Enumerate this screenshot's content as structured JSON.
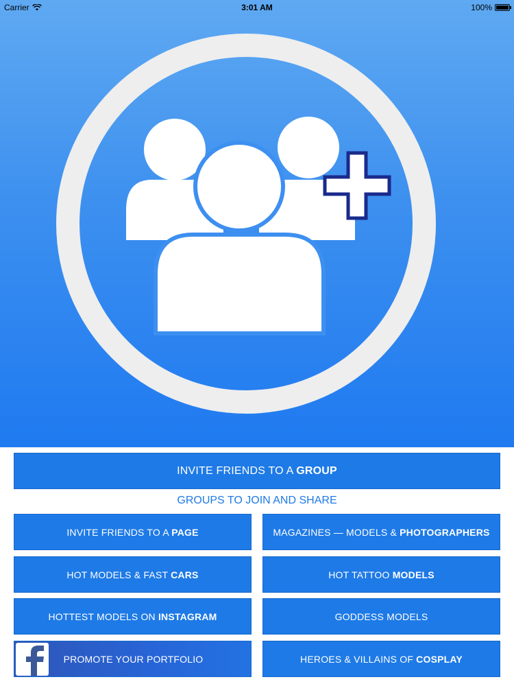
{
  "status_bar": {
    "carrier": "Carrier",
    "time": "3:01 AM",
    "battery_text": "100%",
    "battery_level": 1.0
  },
  "hero": {
    "icon": "group-add-icon",
    "colors": {
      "gradient_top": "#5fa9f2",
      "gradient_bottom": "#1f7af0",
      "ring": "#eeeeee",
      "plus_border": "#1a2a8c"
    }
  },
  "main_button": {
    "text": "INVITE FRIENDS TO A ",
    "bold": "GROUP"
  },
  "section_title": "GROUPS TO JOIN AND SHARE",
  "buttons": [
    {
      "text": "INVITE FRIENDS TO A ",
      "bold": "PAGE"
    },
    {
      "text": "MAGAZINES — MODELS & ",
      "bold": "PHOTOGRAPHERS"
    },
    {
      "text": "HOT MODELS & FAST ",
      "bold": "CARS"
    },
    {
      "text": "HOT TATTOO ",
      "bold": "MODELS"
    },
    {
      "text": "HOTTEST MODELS ON ",
      "bold": "INSTAGRAM"
    },
    {
      "text": "GODDESS MODELS",
      "bold": ""
    },
    {
      "text": "PROMOTE YOUR PORTFOLIO",
      "bold": "",
      "icon": "facebook-icon"
    },
    {
      "text": "HEROES & VILLAINS OF ",
      "bold": "COSPLAY"
    }
  ],
  "colors": {
    "button_bg": "#1e7ae6",
    "button_text": "#ffffff",
    "section_title": "#1e7ae6",
    "facebook_blue": "#3b5998"
  }
}
